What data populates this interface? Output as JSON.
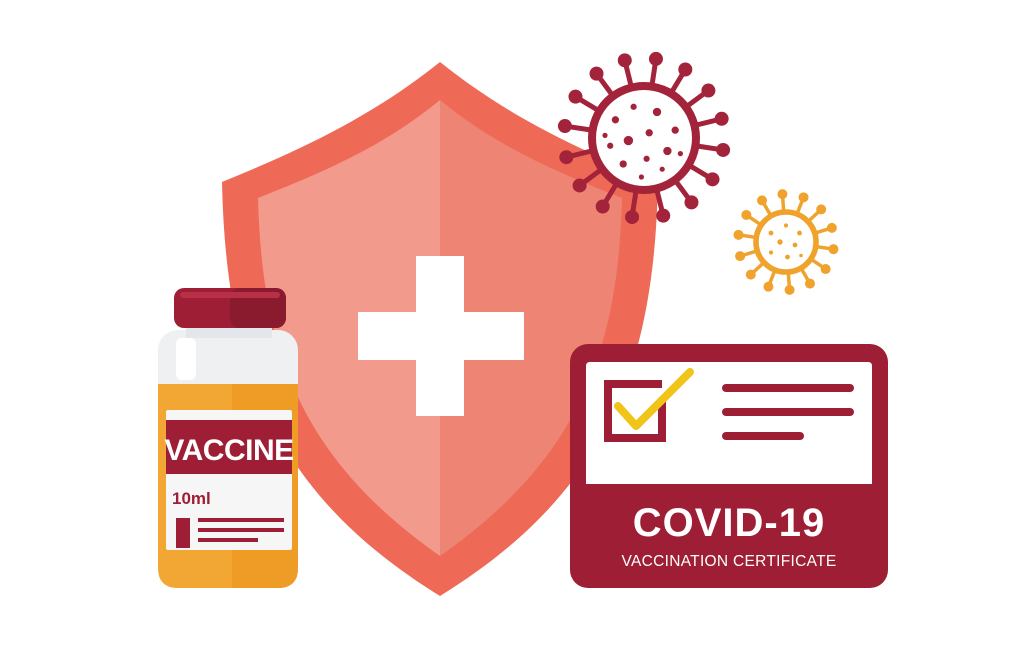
{
  "vial": {
    "label": "VACCINE",
    "volume": "10ml"
  },
  "certificate": {
    "title": "COVID-19",
    "subtitle": "VACCINATION CERTIFICATE",
    "checked": true
  },
  "colors": {
    "background": "#ffffff",
    "shield_outer": "#ef6a56",
    "shield_inner": "#f08f80",
    "cross": "#ffffff",
    "crimson": "#9e1f35",
    "virus_large": "#a3243a",
    "virus_small": "#f0a32c",
    "vial_liquid": "#f2a634",
    "vial_glass": "#eef0f2",
    "check": "#f0c419"
  }
}
